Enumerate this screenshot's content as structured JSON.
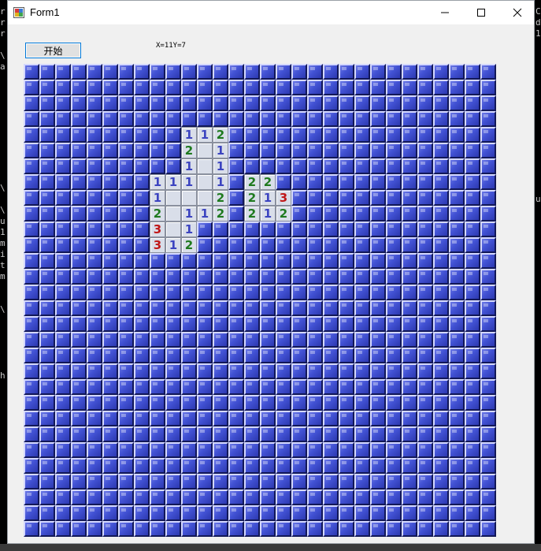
{
  "window": {
    "title": "Form1",
    "controls": {
      "minimize": "—",
      "maximize": "☐",
      "close": "✕"
    }
  },
  "toolbar": {
    "start_label": "开始",
    "coord_text": "X=11Y=7"
  },
  "background_text": {
    "left": [
      "r",
      "r",
      "r",
      "",
      "\\",
      "a",
      "",
      "",
      "",
      "",
      "",
      "",
      "",
      "",
      "",
      "",
      "\\",
      "",
      "\\",
      "u",
      "1",
      "m",
      "i",
      "t",
      "m",
      "",
      "",
      "\\",
      "",
      "",
      "",
      "",
      "",
      "h"
    ],
    "right": [
      "C",
      "d",
      "1",
      "",
      "",
      "",
      "",
      "",
      "",
      "",
      "",
      "",
      "",
      "",
      "",
      "",
      "",
      "u"
    ]
  },
  "board": {
    "columns": 30,
    "rows": 30,
    "colors": {
      "1": "#3c44c0",
      "2": "#1f7a1f",
      "3": "#c01818"
    },
    "cells": [
      {
        "x": 10,
        "y": 4,
        "v": "1"
      },
      {
        "x": 11,
        "y": 4,
        "v": "1"
      },
      {
        "x": 12,
        "y": 4,
        "v": "2"
      },
      {
        "x": 10,
        "y": 5,
        "v": "2"
      },
      {
        "x": 11,
        "y": 5,
        "v": ""
      },
      {
        "x": 12,
        "y": 5,
        "v": "1"
      },
      {
        "x": 10,
        "y": 6,
        "v": "1"
      },
      {
        "x": 11,
        "y": 6,
        "v": ""
      },
      {
        "x": 12,
        "y": 6,
        "v": "1"
      },
      {
        "x": 8,
        "y": 7,
        "v": "1"
      },
      {
        "x": 9,
        "y": 7,
        "v": "1"
      },
      {
        "x": 10,
        "y": 7,
        "v": "1"
      },
      {
        "x": 11,
        "y": 7,
        "v": ""
      },
      {
        "x": 12,
        "y": 7,
        "v": "1"
      },
      {
        "x": 14,
        "y": 7,
        "v": "2"
      },
      {
        "x": 15,
        "y": 7,
        "v": "2"
      },
      {
        "x": 8,
        "y": 8,
        "v": "1"
      },
      {
        "x": 9,
        "y": 8,
        "v": ""
      },
      {
        "x": 10,
        "y": 8,
        "v": ""
      },
      {
        "x": 11,
        "y": 8,
        "v": ""
      },
      {
        "x": 12,
        "y": 8,
        "v": "2"
      },
      {
        "x": 14,
        "y": 8,
        "v": "2"
      },
      {
        "x": 15,
        "y": 8,
        "v": "1"
      },
      {
        "x": 16,
        "y": 8,
        "v": "3"
      },
      {
        "x": 8,
        "y": 9,
        "v": "2"
      },
      {
        "x": 9,
        "y": 9,
        "v": ""
      },
      {
        "x": 10,
        "y": 9,
        "v": "1"
      },
      {
        "x": 11,
        "y": 9,
        "v": "1"
      },
      {
        "x": 12,
        "y": 9,
        "v": "2"
      },
      {
        "x": 14,
        "y": 9,
        "v": "2"
      },
      {
        "x": 15,
        "y": 9,
        "v": "1"
      },
      {
        "x": 16,
        "y": 9,
        "v": "2"
      },
      {
        "x": 8,
        "y": 10,
        "v": "3"
      },
      {
        "x": 9,
        "y": 10,
        "v": ""
      },
      {
        "x": 10,
        "y": 10,
        "v": "1"
      },
      {
        "x": 8,
        "y": 11,
        "v": "3"
      },
      {
        "x": 9,
        "y": 11,
        "v": "1"
      },
      {
        "x": 10,
        "y": 11,
        "v": "2"
      }
    ]
  }
}
